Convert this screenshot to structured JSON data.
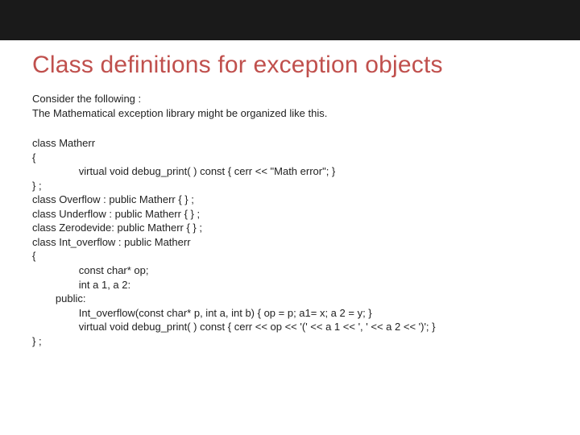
{
  "title": "Class definitions for exception objects",
  "intro_line1": "Consider the following :",
  "intro_line2": "The Mathematical exception library might be organized like this.",
  "code": "class Matherr\n{\n                virtual void debug_print( ) const { cerr << \"Math error\"; }\n} ;\nclass Overflow : public Matherr { } ;\nclass Underflow : public Matherr { } ;\nclass Zerodevide: public Matherr { } ;\nclass Int_overflow : public Matherr\n{\n                const char* op;\n                int a 1, a 2:\n        public:\n                Int_overflow(const char* p, int a, int b) { op = p; a1= x; a 2 = y; }\n                virtual void debug_print( ) const { cerr << op << '(' << a 1 << ', ' << a 2 << ')'; }\n} ;"
}
